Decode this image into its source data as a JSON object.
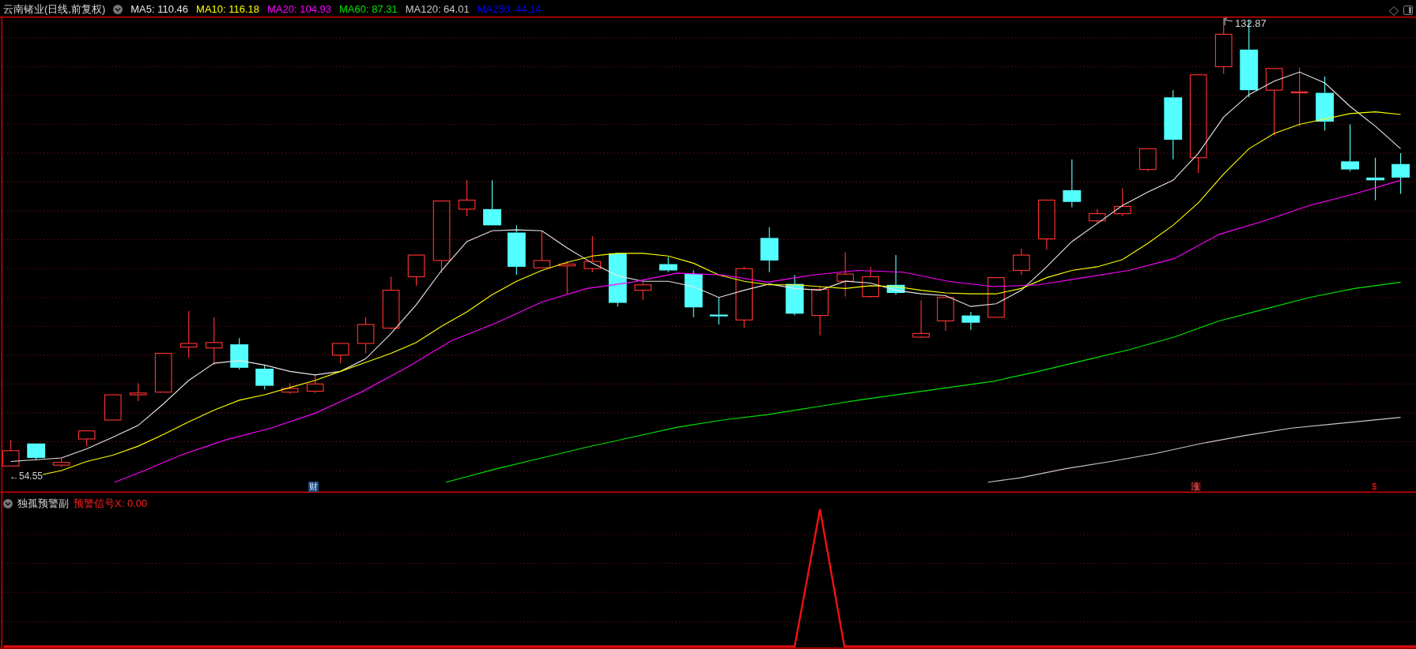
{
  "main_panel": {
    "title": "云南锗业(日线,前复权)",
    "moving_averages": [
      {
        "label": "MA5: 110.46",
        "color": "#e6e6e6"
      },
      {
        "label": "MA10: 116.18",
        "color": "#ffff00"
      },
      {
        "label": "MA20: 104.93",
        "color": "#ff00ff"
      },
      {
        "label": "MA60: 87.31",
        "color": "#00e600"
      },
      {
        "label": "MA120: 64.01",
        "color": "#c8c8c8"
      },
      {
        "label": "MA250: 44.14",
        "color": "#0000ff"
      }
    ],
    "high_label": "132.87",
    "low_label": "←54.55",
    "markers": [
      {
        "text": "财",
        "kind": "news"
      },
      {
        "text": "涨",
        "kind": "rise"
      },
      {
        "text": "$",
        "kind": "money"
      }
    ]
  },
  "sub_panel": {
    "title": "独孤预警副",
    "indicator": "预警信号X: 0.00"
  }
}
